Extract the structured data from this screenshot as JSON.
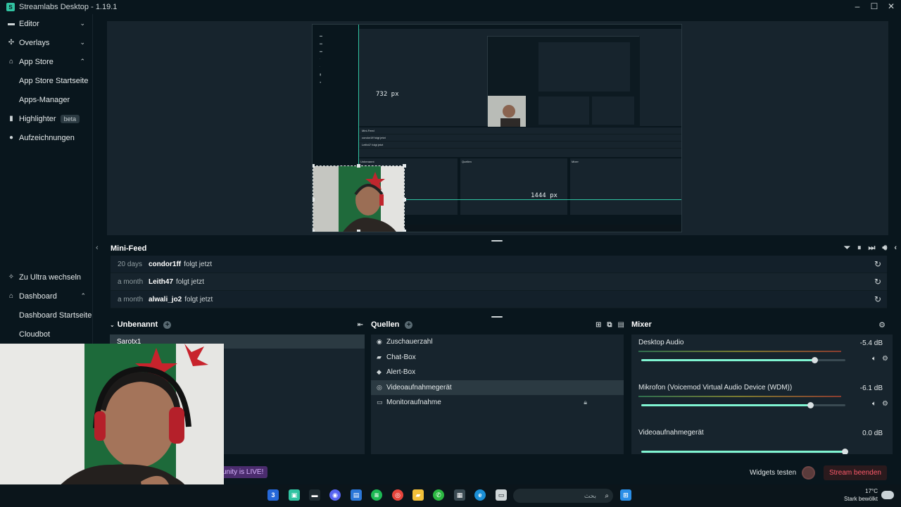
{
  "window": {
    "title": "Streamlabs Desktop - 1.19.1",
    "app_icon": "S"
  },
  "sidebar": {
    "items": [
      {
        "label": "Editor",
        "icon": "editor-icon"
      },
      {
        "label": "Overlays",
        "icon": "overlays-icon"
      },
      {
        "label": "App Store",
        "icon": "store-icon"
      },
      {
        "label": "App Store Startseite"
      },
      {
        "label": "Apps-Manager"
      },
      {
        "label": "Highlighter",
        "badge": "beta",
        "icon": "highlighter-icon"
      },
      {
        "label": "Aufzeichnungen",
        "icon": "recordings-icon"
      }
    ],
    "bottom": [
      {
        "label": "Zu Ultra wechseln",
        "icon": "ultra-icon"
      },
      {
        "label": "Dashboard",
        "icon": "dashboard-icon"
      },
      {
        "label": "Dashboard Startseite"
      },
      {
        "label": "Cloudbot"
      }
    ]
  },
  "editor": {
    "width_label": "732 px",
    "height_label": "1444 px"
  },
  "minifeed": {
    "title": "Mini-Feed",
    "rows": [
      {
        "time": "20 days",
        "user": "condor1ff",
        "action": "folgt jetzt"
      },
      {
        "time": "a month",
        "user": "Leith47",
        "action": "folgt jetzt"
      },
      {
        "time": "a month",
        "user": "alwali_jo2",
        "action": "folgt jetzt"
      }
    ]
  },
  "scenes": {
    "title": "Unbenannt",
    "items": [
      "Sarotx1"
    ]
  },
  "sources": {
    "title": "Quellen",
    "items": [
      {
        "label": "Zuschauerzahl",
        "icon": "eye-icon"
      },
      {
        "label": "Chat-Box",
        "icon": "chat-icon"
      },
      {
        "label": "Alert-Box",
        "icon": "alert-icon"
      },
      {
        "label": "Videoaufnahmegerät",
        "icon": "webcam-icon"
      },
      {
        "label": "Monitoraufnahme",
        "icon": "monitor-icon"
      }
    ]
  },
  "mixer": {
    "title": "Mixer",
    "channels": [
      {
        "name": "Desktop Audio",
        "db": "-5.4 dB",
        "volume": 0.85
      },
      {
        "name": "Mikrofon (Voicemod Virtual Audio Device (WDM))",
        "db": "-6.1 dB",
        "volume": 0.83
      },
      {
        "name": "Videoaufnahmegerät",
        "db": "0.0 dB",
        "volume": 1.0
      }
    ]
  },
  "bottom_bar": {
    "live_text": "unity is LIVE!",
    "widgets_test": "Widgets testen",
    "stream_end": "Stream beenden"
  },
  "taskbar": {
    "search_placeholder": "بحث",
    "temperature": "17°C",
    "weather": "Stark bewölkt"
  }
}
